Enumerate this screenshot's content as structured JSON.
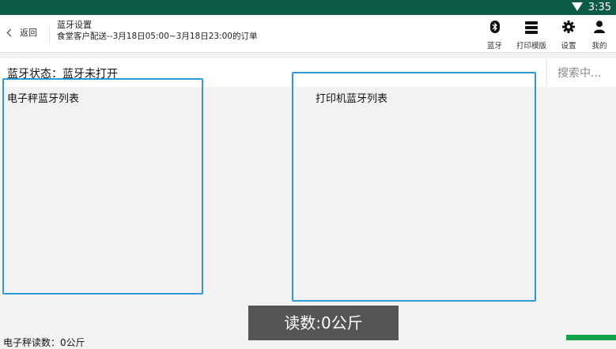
{
  "status_bar": {
    "time": "3:35",
    "wifi_icon": "wifi-icon"
  },
  "header": {
    "back_label": "返回",
    "title": "蓝牙设置",
    "subtitle": "食堂客户配送--3月18日05:00~3月18日23:00的订单",
    "tools": [
      {
        "icon": "bluetooth-icon",
        "label": "蓝牙"
      },
      {
        "icon": "printer-template-icon",
        "label": "打印模版"
      },
      {
        "icon": "gear-icon",
        "label": "设置"
      },
      {
        "icon": "person-icon",
        "label": "我的"
      }
    ]
  },
  "bluetooth_status": "蓝牙状态：蓝牙未打开",
  "search_status": "搜索中...",
  "scale_list": {
    "title": "电子秤蓝牙列表"
  },
  "printer_list": {
    "title": "打印机蓝牙列表"
  },
  "scale_reading_text": "电子秤读数：0公斤",
  "toast": "读数:0公斤",
  "colors": {
    "statusbar": "#0e5b45",
    "accent": "#2d9ad6",
    "green_button": "#14a34a"
  }
}
